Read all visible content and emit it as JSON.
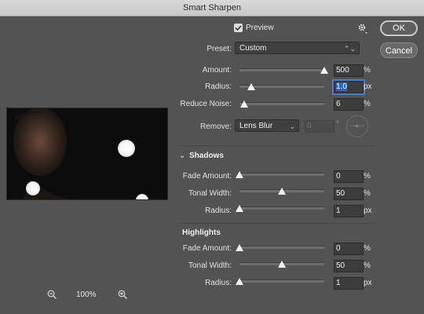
{
  "window": {
    "title": "Smart Sharpen"
  },
  "preview_checkbox": {
    "label": "Preview",
    "checked": true
  },
  "buttons": {
    "ok": "OK",
    "cancel": "Cancel"
  },
  "preset": {
    "label": "Preset:",
    "value": "Custom"
  },
  "amount": {
    "label": "Amount:",
    "value": "500",
    "unit": "%",
    "level": 1.0
  },
  "radius": {
    "label": "Radius:",
    "value": "1.0",
    "unit": "px",
    "level": 0.14
  },
  "reduce_noise": {
    "label": "Reduce Noise:",
    "value": "6",
    "unit": "%",
    "level": 0.06
  },
  "remove": {
    "label": "Remove:",
    "value": "Lens Blur",
    "angle": "0",
    "degree": "°"
  },
  "shadows": {
    "title": "Shadows",
    "fade_amount": {
      "label": "Fade Amount:",
      "value": "0",
      "unit": "%",
      "level": 0.0
    },
    "tonal_width": {
      "label": "Tonal Width:",
      "value": "50",
      "unit": "%",
      "level": 0.5
    },
    "radius": {
      "label": "Radius:",
      "value": "1",
      "unit": "px",
      "level": 0.0
    }
  },
  "highlights": {
    "title": "Highlights",
    "fade_amount": {
      "label": "Fade Amount:",
      "value": "0",
      "unit": "%",
      "level": 0.0
    },
    "tonal_width": {
      "label": "Tonal Width:",
      "value": "50",
      "unit": "%",
      "level": 0.5
    },
    "radius": {
      "label": "Radius:",
      "value": "1",
      "unit": "px",
      "level": 0.0
    }
  },
  "zoom": {
    "value": "100%"
  },
  "icons": {
    "settings": "gear-icon",
    "zoom_out": "zoom-out-icon",
    "zoom_in": "zoom-in-icon"
  }
}
